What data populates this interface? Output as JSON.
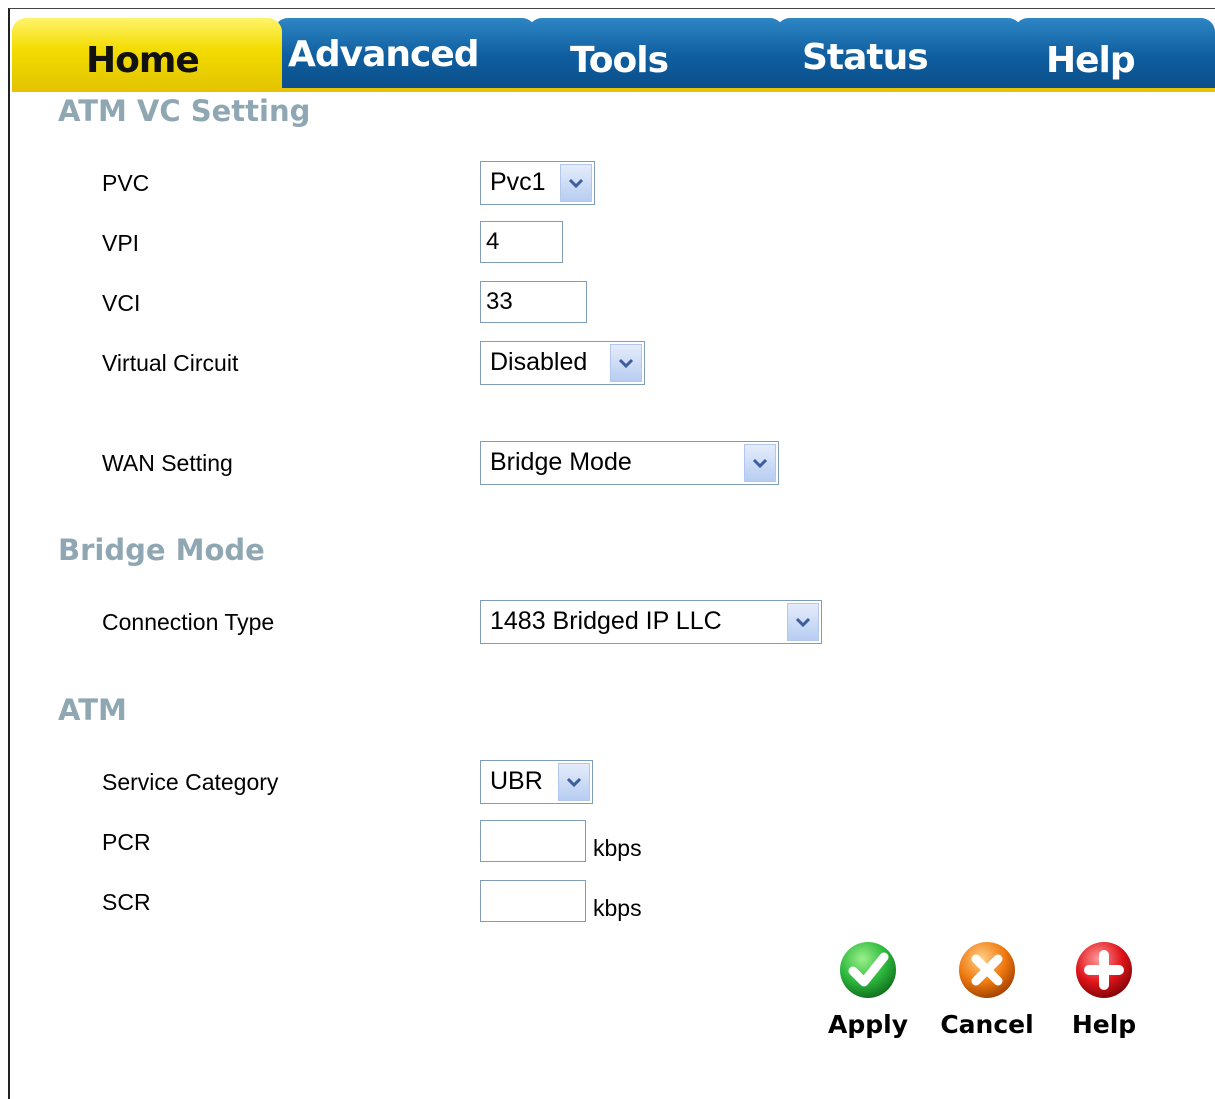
{
  "tabs": {
    "home": "Home",
    "advanced": "Advanced",
    "tools": "Tools",
    "status": "Status",
    "help": "Help"
  },
  "atm_vc_setting": {
    "heading": "ATM VC Setting",
    "pvc": {
      "label": "PVC",
      "value": "Pvc1"
    },
    "vpi": {
      "label": "VPI",
      "value": "4"
    },
    "vci": {
      "label": "VCI",
      "value": "33"
    },
    "virtual_circuit": {
      "label": "Virtual Circuit",
      "value": "Disabled"
    },
    "wan_setting": {
      "label": "WAN Setting",
      "value": "Bridge Mode"
    }
  },
  "bridge_mode": {
    "heading": "Bridge Mode",
    "connection_type": {
      "label": "Connection Type",
      "value": "1483 Bridged IP LLC"
    }
  },
  "atm": {
    "heading": "ATM",
    "service_category": {
      "label": "Service Category",
      "value": "UBR"
    },
    "pcr": {
      "label": "PCR",
      "value": "",
      "unit": "kbps"
    },
    "scr": {
      "label": "SCR",
      "value": "",
      "unit": "kbps"
    }
  },
  "actions": {
    "apply": "Apply",
    "cancel": "Cancel",
    "help": "Help"
  },
  "colors": {
    "active_tab": "#f3dc00",
    "inactive_tab": "#0f5e9f",
    "section_heading": "#8fa6b3",
    "apply_icon": "#2db83d",
    "cancel_icon": "#f07a10",
    "help_icon": "#e0151b"
  }
}
